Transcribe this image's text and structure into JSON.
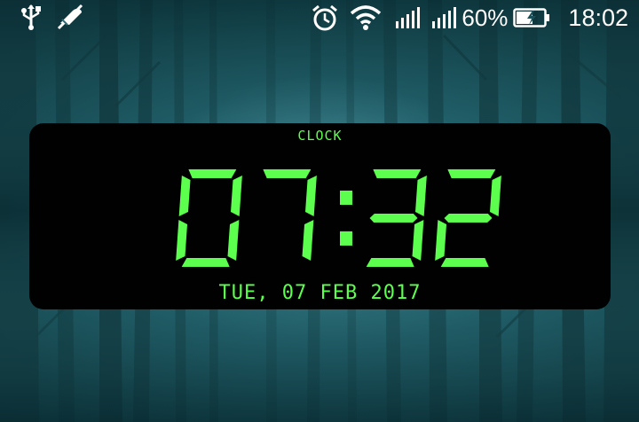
{
  "status_bar": {
    "left_icons": [
      "usb-icon",
      "notification-muted-icon"
    ],
    "alarm_icon": "alarm-clock-icon",
    "wifi_icon": "wifi-icon",
    "signal_bars": 2,
    "battery_percent": "60%",
    "battery_level": 0.6,
    "battery_state": "charging",
    "time": "18:02"
  },
  "widget": {
    "title": "CLOCK",
    "time": "07:32",
    "date": "TUE, 07 FEB 2017",
    "color": "#5dff4e",
    "background": "#010101"
  },
  "wallpaper": {
    "description_colors": [
      "#0e3940",
      "#3f8a93"
    ]
  }
}
